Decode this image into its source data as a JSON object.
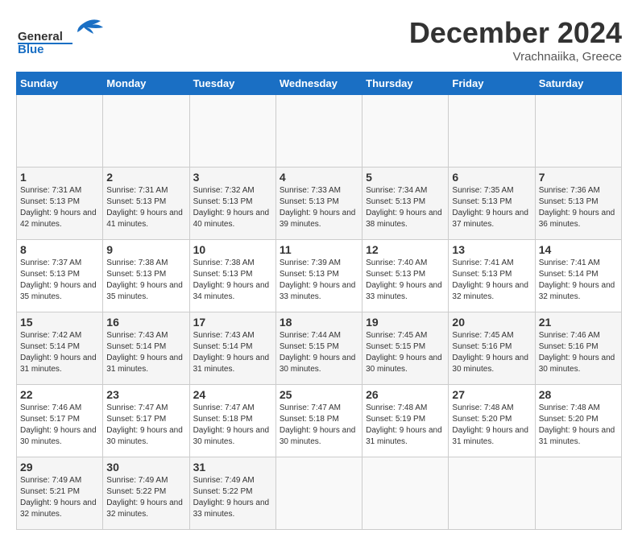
{
  "header": {
    "logo_general": "General",
    "logo_blue": "Blue",
    "month_title": "December 2024",
    "location": "Vrachnaiika, Greece"
  },
  "calendar": {
    "days_of_week": [
      "Sunday",
      "Monday",
      "Tuesday",
      "Wednesday",
      "Thursday",
      "Friday",
      "Saturday"
    ],
    "weeks": [
      [
        {
          "day": "",
          "empty": true
        },
        {
          "day": "",
          "empty": true
        },
        {
          "day": "",
          "empty": true
        },
        {
          "day": "",
          "empty": true
        },
        {
          "day": "",
          "empty": true
        },
        {
          "day": "",
          "empty": true
        },
        {
          "day": "",
          "empty": true
        }
      ],
      [
        {
          "num": "1",
          "sunrise": "7:31 AM",
          "sunset": "5:13 PM",
          "daylight": "9 hours and 42 minutes."
        },
        {
          "num": "2",
          "sunrise": "7:31 AM",
          "sunset": "5:13 PM",
          "daylight": "9 hours and 41 minutes."
        },
        {
          "num": "3",
          "sunrise": "7:32 AM",
          "sunset": "5:13 PM",
          "daylight": "9 hours and 40 minutes."
        },
        {
          "num": "4",
          "sunrise": "7:33 AM",
          "sunset": "5:13 PM",
          "daylight": "9 hours and 39 minutes."
        },
        {
          "num": "5",
          "sunrise": "7:34 AM",
          "sunset": "5:13 PM",
          "daylight": "9 hours and 38 minutes."
        },
        {
          "num": "6",
          "sunrise": "7:35 AM",
          "sunset": "5:13 PM",
          "daylight": "9 hours and 37 minutes."
        },
        {
          "num": "7",
          "sunrise": "7:36 AM",
          "sunset": "5:13 PM",
          "daylight": "9 hours and 36 minutes."
        }
      ],
      [
        {
          "num": "8",
          "sunrise": "7:37 AM",
          "sunset": "5:13 PM",
          "daylight": "9 hours and 35 minutes."
        },
        {
          "num": "9",
          "sunrise": "7:38 AM",
          "sunset": "5:13 PM",
          "daylight": "9 hours and 35 minutes."
        },
        {
          "num": "10",
          "sunrise": "7:38 AM",
          "sunset": "5:13 PM",
          "daylight": "9 hours and 34 minutes."
        },
        {
          "num": "11",
          "sunrise": "7:39 AM",
          "sunset": "5:13 PM",
          "daylight": "9 hours and 33 minutes."
        },
        {
          "num": "12",
          "sunrise": "7:40 AM",
          "sunset": "5:13 PM",
          "daylight": "9 hours and 33 minutes."
        },
        {
          "num": "13",
          "sunrise": "7:41 AM",
          "sunset": "5:13 PM",
          "daylight": "9 hours and 32 minutes."
        },
        {
          "num": "14",
          "sunrise": "7:41 AM",
          "sunset": "5:14 PM",
          "daylight": "9 hours and 32 minutes."
        }
      ],
      [
        {
          "num": "15",
          "sunrise": "7:42 AM",
          "sunset": "5:14 PM",
          "daylight": "9 hours and 31 minutes."
        },
        {
          "num": "16",
          "sunrise": "7:43 AM",
          "sunset": "5:14 PM",
          "daylight": "9 hours and 31 minutes."
        },
        {
          "num": "17",
          "sunrise": "7:43 AM",
          "sunset": "5:14 PM",
          "daylight": "9 hours and 31 minutes."
        },
        {
          "num": "18",
          "sunrise": "7:44 AM",
          "sunset": "5:15 PM",
          "daylight": "9 hours and 30 minutes."
        },
        {
          "num": "19",
          "sunrise": "7:45 AM",
          "sunset": "5:15 PM",
          "daylight": "9 hours and 30 minutes."
        },
        {
          "num": "20",
          "sunrise": "7:45 AM",
          "sunset": "5:16 PM",
          "daylight": "9 hours and 30 minutes."
        },
        {
          "num": "21",
          "sunrise": "7:46 AM",
          "sunset": "5:16 PM",
          "daylight": "9 hours and 30 minutes."
        }
      ],
      [
        {
          "num": "22",
          "sunrise": "7:46 AM",
          "sunset": "5:17 PM",
          "daylight": "9 hours and 30 minutes."
        },
        {
          "num": "23",
          "sunrise": "7:47 AM",
          "sunset": "5:17 PM",
          "daylight": "9 hours and 30 minutes."
        },
        {
          "num": "24",
          "sunrise": "7:47 AM",
          "sunset": "5:18 PM",
          "daylight": "9 hours and 30 minutes."
        },
        {
          "num": "25",
          "sunrise": "7:47 AM",
          "sunset": "5:18 PM",
          "daylight": "9 hours and 30 minutes."
        },
        {
          "num": "26",
          "sunrise": "7:48 AM",
          "sunset": "5:19 PM",
          "daylight": "9 hours and 31 minutes."
        },
        {
          "num": "27",
          "sunrise": "7:48 AM",
          "sunset": "5:20 PM",
          "daylight": "9 hours and 31 minutes."
        },
        {
          "num": "28",
          "sunrise": "7:48 AM",
          "sunset": "5:20 PM",
          "daylight": "9 hours and 31 minutes."
        }
      ],
      [
        {
          "num": "29",
          "sunrise": "7:49 AM",
          "sunset": "5:21 PM",
          "daylight": "9 hours and 32 minutes."
        },
        {
          "num": "30",
          "sunrise": "7:49 AM",
          "sunset": "5:22 PM",
          "daylight": "9 hours and 32 minutes."
        },
        {
          "num": "31",
          "sunrise": "7:49 AM",
          "sunset": "5:22 PM",
          "daylight": "9 hours and 33 minutes."
        },
        {
          "day": "",
          "empty": true
        },
        {
          "day": "",
          "empty": true
        },
        {
          "day": "",
          "empty": true
        },
        {
          "day": "",
          "empty": true
        }
      ]
    ]
  }
}
